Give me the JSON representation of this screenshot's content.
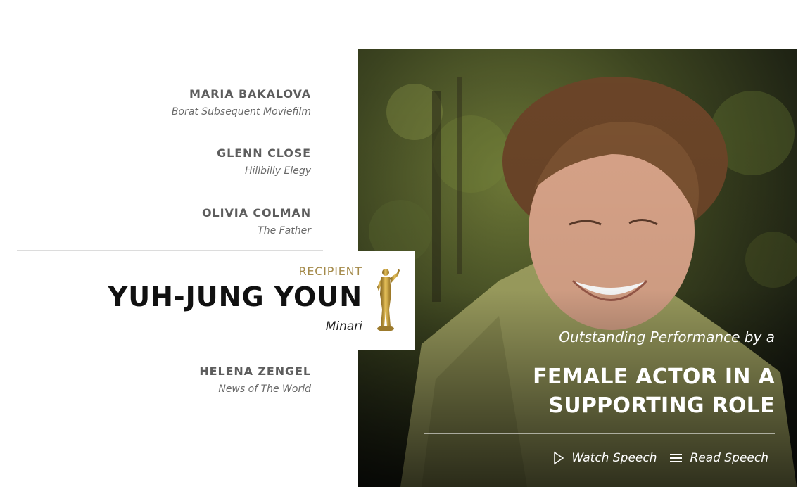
{
  "nominees": [
    {
      "name": "MARIA BAKALOVA",
      "film": "Borat Subsequent Moviefilm"
    },
    {
      "name": "GLENN CLOSE",
      "film": "Hillbilly Elegy"
    },
    {
      "name": "OLIVIA COLMAN",
      "film": "The Father"
    }
  ],
  "winner": {
    "label": "RECIPIENT",
    "name": "YUH-JUNG YOUN",
    "film": "Minari"
  },
  "last_nominee": {
    "name": "HELENA ZENGEL",
    "film": "News of The World"
  },
  "category": {
    "prefix": "Outstanding Performance by a",
    "title_line1": "FEMALE ACTOR IN A",
    "title_line2": "SUPPORTING ROLE"
  },
  "actions": {
    "watch": "Watch Speech",
    "read": "Read Speech"
  },
  "colors": {
    "accent_gold": "#a48a4a"
  }
}
